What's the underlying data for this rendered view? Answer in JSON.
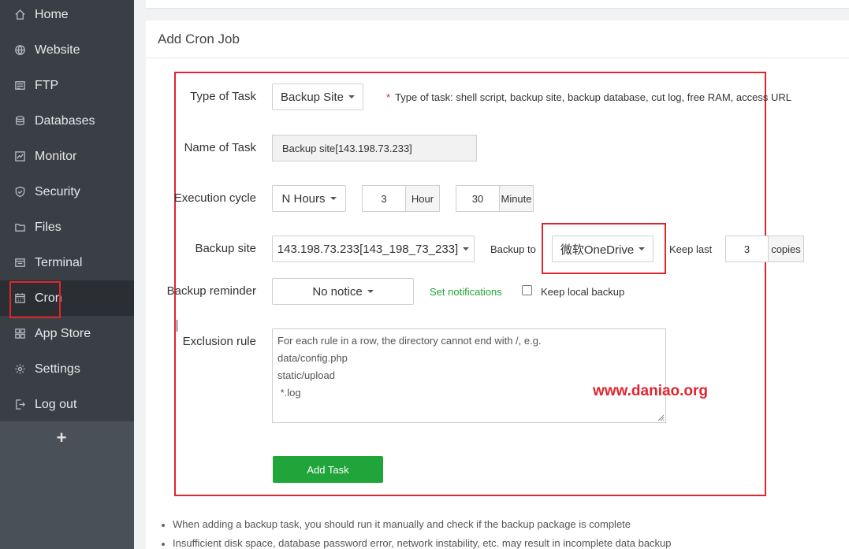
{
  "sidebar": {
    "items": [
      {
        "label": "Home",
        "icon": "home-icon"
      },
      {
        "label": "Website",
        "icon": "globe-icon"
      },
      {
        "label": "FTP",
        "icon": "ftp-icon"
      },
      {
        "label": "Databases",
        "icon": "database-icon"
      },
      {
        "label": "Monitor",
        "icon": "monitor-icon"
      },
      {
        "label": "Security",
        "icon": "shield-icon"
      },
      {
        "label": "Files",
        "icon": "folder-icon"
      },
      {
        "label": "Terminal",
        "icon": "terminal-icon"
      },
      {
        "label": "Cron",
        "icon": "calendar-icon"
      },
      {
        "label": "App Store",
        "icon": "grid-icon"
      },
      {
        "label": "Settings",
        "icon": "gear-icon"
      },
      {
        "label": "Log out",
        "icon": "logout-icon"
      }
    ],
    "active": "Cron",
    "add_label": "+"
  },
  "panel": {
    "title": "Add Cron Job"
  },
  "form": {
    "type_label": "Type of Task",
    "type_value": "Backup Site",
    "type_hint": "Type of task: shell script, backup site, backup database, cut log, free RAM, access URL",
    "name_label": "Name of Task",
    "name_value": "Backup site[143.198.73.233]",
    "cycle_label": "Execution cycle",
    "cycle_value": "N Hours",
    "hour_value": "3",
    "hour_unit": "Hour",
    "minute_value": "30",
    "minute_unit": "Minute",
    "site_label": "Backup site",
    "site_value": "143.198.73.233[143_198_73_233]",
    "backup_to_label": "Backup to",
    "backup_to_value": "微软OneDrive",
    "keep_last_label": "Keep last",
    "keep_last_value": "3",
    "keep_last_unit": "copies",
    "reminder_label": "Backup reminder",
    "reminder_value": "No notice",
    "set_notifications": "Set notifications",
    "keep_local_label": "Keep local backup",
    "keep_local_checked": false,
    "exclusion_label": "Exclusion rule",
    "exclusion_lines": [
      "For each rule in a row, the directory cannot end with /, e.g.",
      "data/config.php",
      "static/upload",
      " *.log"
    ],
    "submit_label": "Add Task"
  },
  "watermark": "www.daniao.org",
  "notes": [
    "When adding a backup task, you should run it manually and check if the backup package is complete",
    "Insufficient disk space, database password error, network instability, etc. may result in incomplete data backup"
  ],
  "colors": {
    "sidebar_bg": "#3a3f45",
    "accent_green": "#20a53a",
    "annotation_red": "#e0262d"
  }
}
